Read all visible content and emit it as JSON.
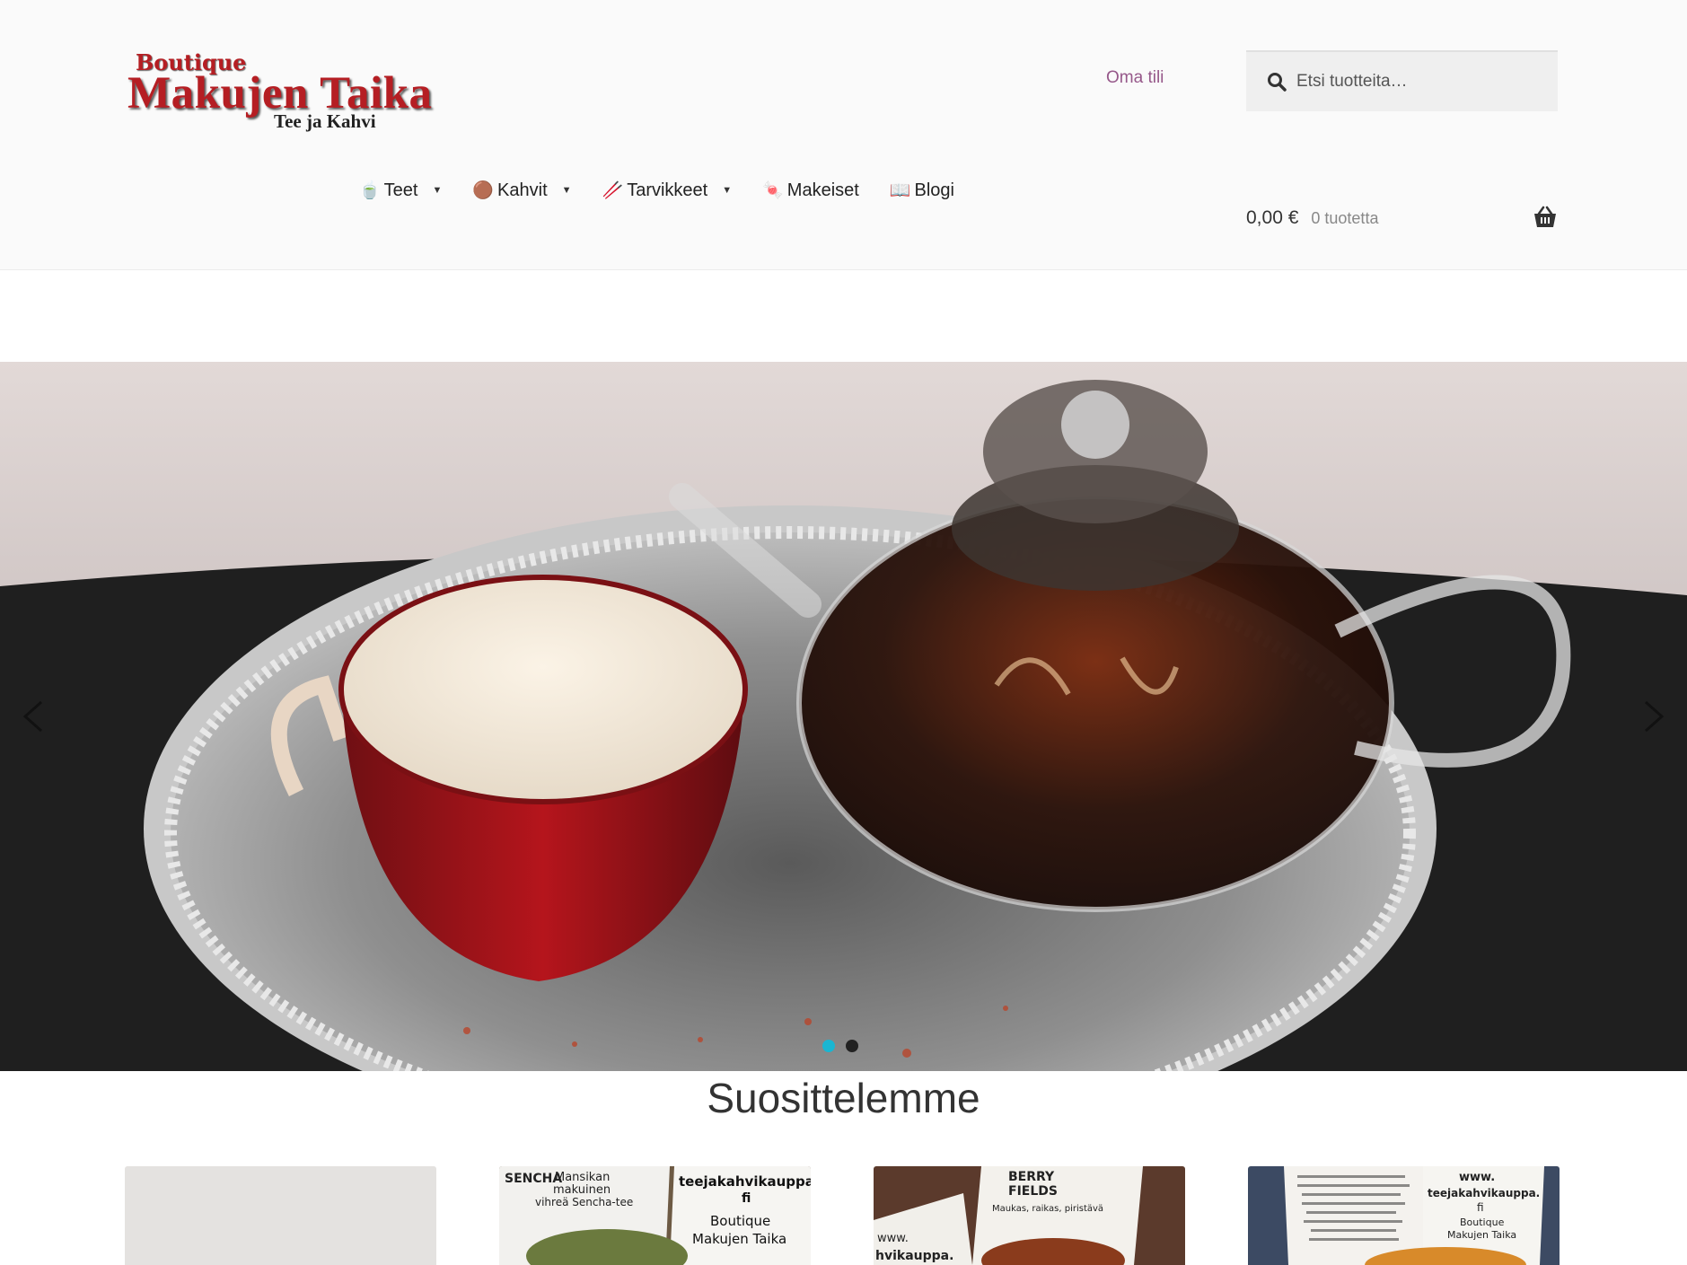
{
  "brand": {
    "line1": "Boutique",
    "line2": "Makujen Taika",
    "line3": "Tee ja Kahvi"
  },
  "header": {
    "account_label": "Oma tili",
    "search_placeholder": "Etsi tuotteita…"
  },
  "nav": {
    "items": [
      {
        "icon": "🍵",
        "label": "Teet",
        "has_dropdown": true
      },
      {
        "icon": "🟤",
        "label": "Kahvit",
        "has_dropdown": true
      },
      {
        "icon": "🥢",
        "label": "Tarvikkeet",
        "has_dropdown": true
      },
      {
        "icon": "🍬",
        "label": "Makeiset",
        "has_dropdown": false
      },
      {
        "icon": "📖",
        "label": "Blogi",
        "has_dropdown": false
      }
    ]
  },
  "cart": {
    "amount": "0,00 €",
    "count": "0 tuotetta"
  },
  "slider": {
    "active_slide": 1,
    "total_slides": 2
  },
  "section": {
    "title": "Suosittelemme"
  },
  "products": {
    "card2_text": [
      "SENCHA",
      "Mansikan",
      "makuinen",
      "vihreä Sencha-tee",
      "teejakahvikauppa.",
      "fi",
      "Boutique",
      "Makujen Taika"
    ],
    "card3_text": [
      "BERRY",
      "FIELDS",
      "Maukas, raikas, piristävä",
      "www.",
      "hvikauppa."
    ],
    "card4_text": [
      "www.",
      "teejakahvikauppa.",
      "fi",
      "Boutique",
      "Makujen Taika"
    ]
  },
  "colors": {
    "accent_link": "#96588a",
    "brand_red": "#b51e23",
    "slider_dot_active": "#19b6d2"
  }
}
